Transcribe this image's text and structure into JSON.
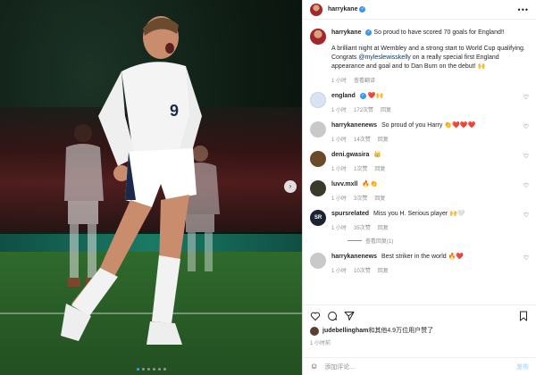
{
  "post": {
    "username": "harrykane",
    "more_label": "•••"
  },
  "caption": {
    "username": "harrykane",
    "text": "So proud to have scored 70 goals for England!!",
    "para_a": "A brilliant night at Wembley and a strong start to World Cup qualifying. Congrats",
    "mention": "@myleslewisskelly",
    "para_b": "on a really special first England appearance and goal and to Dan Burn on the debut!",
    "para_emoji": "🙌",
    "time": "1 小时",
    "translate": "查看翻译"
  },
  "comments": [
    {
      "user": "england",
      "text": "",
      "emoji": "❤️🙌",
      "time": "1 小时",
      "likes": "172次赞",
      "reply": "回复",
      "avatar_color": "#d9e3f2"
    },
    {
      "user": "harrykanenews",
      "text": "So proud of you Harry",
      "emoji": "👏❤️❤️❤️",
      "time": "1 小时",
      "likes": "14次赞",
      "reply": "回复",
      "avatar_color": "#c9c9c9"
    },
    {
      "user": "deni.gwasira",
      "text": "",
      "emoji": "👑",
      "time": "1 小时",
      "likes": "1次赞",
      "reply": "回复",
      "avatar_color": "#6b4a2a"
    },
    {
      "user": "luvv.mxll",
      "text": "",
      "emoji": "🔥👏",
      "time": "1 小时",
      "likes": "3次赞",
      "reply": "回复",
      "avatar_color": "#3a3a2a"
    },
    {
      "user": "spursrelated",
      "text": "Miss you H. Serious player",
      "emoji": "🙌🤍",
      "time": "1 小时",
      "likes": "35次赞",
      "reply": "回复",
      "avatar_color": "#1b2233"
    }
  ],
  "view_replies": "查看回复(1)",
  "comment6": {
    "user": "harrykanenews",
    "text": "Best striker in the world",
    "emoji": "🔥❤️",
    "time": "1 小时",
    "likes": "10次赞",
    "reply": "回复",
    "avatar_color": "#c9c9c9"
  },
  "likes": {
    "first_user": "judebellingham",
    "rest": "和其他4.9万位用户赞了"
  },
  "post_time": "1 小时前",
  "add_comment": {
    "placeholder": "添加评论...",
    "post_label": "发布"
  },
  "colors": {
    "link": "#00376b",
    "verified": "#3897f0",
    "heart": "#ed4956"
  }
}
